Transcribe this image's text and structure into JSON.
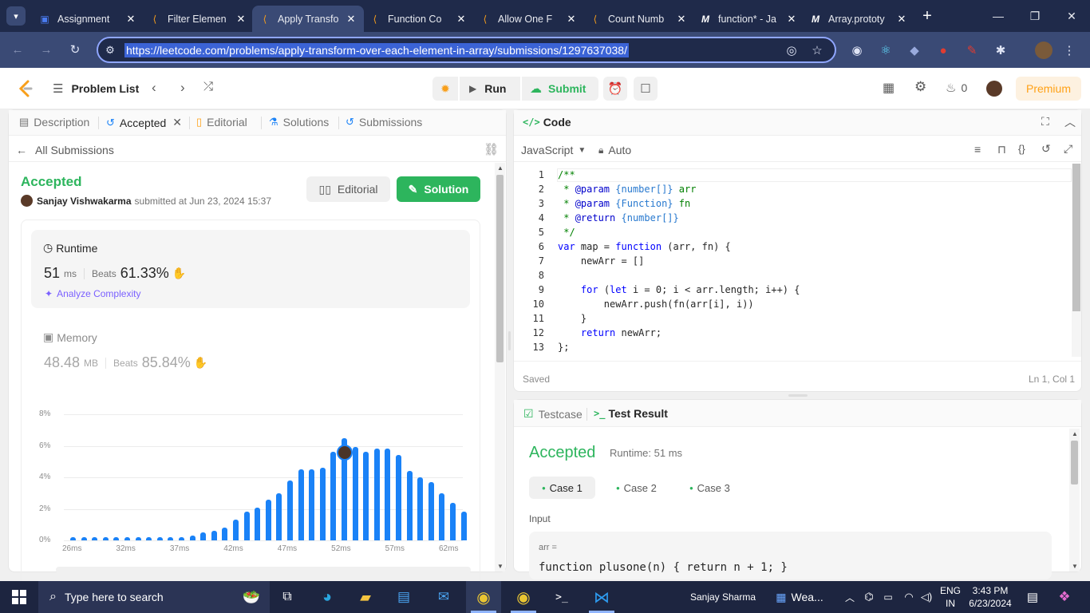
{
  "browser": {
    "tabs": [
      {
        "title": "Assignment",
        "icon": "classroom-icon"
      },
      {
        "title": "Filter Elemen",
        "icon": "leetcode-icon"
      },
      {
        "title": "Apply Transfo",
        "icon": "leetcode-icon",
        "active": true
      },
      {
        "title": "Function Co",
        "icon": "leetcode-icon"
      },
      {
        "title": "Allow One F",
        "icon": "leetcode-icon"
      },
      {
        "title": "Count Numb",
        "icon": "leetcode-icon"
      },
      {
        "title": "function* - Ja",
        "icon": "mdn-icon"
      },
      {
        "title": "Array.prototy",
        "icon": "mdn-icon"
      }
    ],
    "url": "https://leetcode.com/problems/apply-transform-over-each-element-in-array/submissions/1297637038/"
  },
  "header": {
    "problem_list": "Problem List",
    "run": "Run",
    "submit": "Submit",
    "streak": "0",
    "premium": "Premium"
  },
  "left_tabs": {
    "description": "Description",
    "accepted": "Accepted",
    "editorial": "Editorial",
    "solutions": "Solutions",
    "submissions": "Submissions"
  },
  "submission": {
    "back": "All Submissions",
    "status": "Accepted",
    "user": "Sanjay Vishwakarma",
    "submitted_at": "submitted at Jun 23, 2024 15:37",
    "editorial_btn": "Editorial",
    "solution_btn": "Solution",
    "runtime_label": "Runtime",
    "runtime_value": "51",
    "runtime_unit": "ms",
    "beats_label": "Beats",
    "runtime_beats": "61.33%",
    "analyze": "Analyze Complexity",
    "memory_label": "Memory",
    "memory_value": "48.48",
    "memory_unit": "MB",
    "memory_beats": "85.84%"
  },
  "chart_data": {
    "type": "bar",
    "ylim": [
      0,
      8
    ],
    "yticks": [
      "8%",
      "6%",
      "4%",
      "2%",
      "0%"
    ],
    "xticks": [
      "26ms",
      "32ms",
      "37ms",
      "42ms",
      "47ms",
      "52ms",
      "57ms",
      "62ms"
    ],
    "values": [
      0.2,
      0.2,
      0.2,
      0.2,
      0.2,
      0.2,
      0.2,
      0.2,
      0.2,
      0.2,
      0.2,
      0.3,
      0.5,
      0.6,
      0.8,
      1.3,
      1.8,
      2.1,
      2.6,
      3.0,
      3.8,
      4.5,
      4.5,
      4.6,
      5.6,
      6.5,
      5.9,
      5.6,
      5.8,
      5.8,
      5.4,
      4.4,
      4.0,
      3.7,
      3.0,
      2.4,
      1.8
    ],
    "highlight_index": 25,
    "grid": true
  },
  "editor": {
    "title": "Code",
    "language": "JavaScript",
    "mode": "Auto",
    "status_saved": "Saved",
    "cursor": "Ln 1, Col 1",
    "lines": [
      "1",
      "2",
      "3",
      "4",
      "5",
      "6",
      "7",
      "8",
      "9",
      "10",
      "11",
      "12",
      "13"
    ]
  },
  "result": {
    "testcase_tab": "Testcase",
    "result_tab": "Test Result",
    "status": "Accepted",
    "runtime": "Runtime: 51 ms",
    "cases": [
      "Case 1",
      "Case 2",
      "Case 3"
    ],
    "input_label": "Input",
    "arg_name": "arr =",
    "arg_value": "function plusone(n) { return n + 1; }"
  },
  "taskbar": {
    "search_placeholder": "Type here to search",
    "user": "Sanjay Sharma",
    "weather": "Wea...",
    "lang": "ENG",
    "region": "IN",
    "time": "3:43 PM",
    "date": "6/23/2024"
  }
}
